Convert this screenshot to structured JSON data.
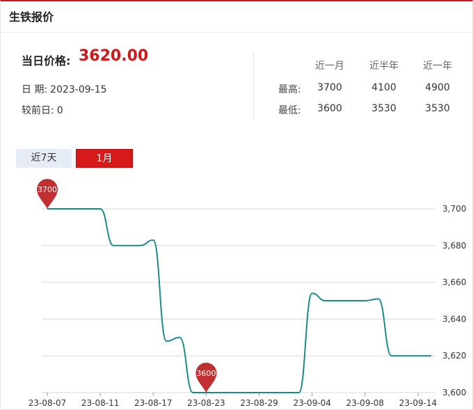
{
  "panel": {
    "title": "生铁报价"
  },
  "current": {
    "label": "当日价格:",
    "price": "3620.00"
  },
  "date": {
    "label": "日 期:",
    "value": "2023-09-15"
  },
  "change": {
    "label": "较前日:",
    "value": "0"
  },
  "stats": {
    "headers": [
      "近一月",
      "近半年",
      "近一年"
    ],
    "rows": [
      {
        "label": "最高:",
        "values": [
          "3700",
          "4100",
          "4900"
        ]
      },
      {
        "label": "最低:",
        "values": [
          "3600",
          "3530",
          "3530"
        ]
      }
    ]
  },
  "tabs": [
    {
      "label": "近7天",
      "active": false
    },
    {
      "label": "1月",
      "active": true
    }
  ],
  "colors": {
    "accent": "#d61a1a",
    "line": "#1a8a8f",
    "grid": "#d9d9d9",
    "marker": "#c03030"
  },
  "chart_data": {
    "type": "line",
    "x": [
      "23-08-07",
      "23-08-08",
      "23-08-09",
      "23-08-10",
      "23-08-11",
      "23-08-14",
      "23-08-15",
      "23-08-16",
      "23-08-17",
      "23-08-18",
      "23-08-21",
      "23-08-22",
      "23-08-23",
      "23-08-24",
      "23-08-25",
      "23-08-28",
      "23-08-29",
      "23-08-30",
      "23-08-31",
      "23-09-01",
      "23-09-04",
      "23-09-05",
      "23-09-06",
      "23-09-07",
      "23-09-08",
      "23-09-11",
      "23-09-12",
      "23-09-13",
      "23-09-14",
      "23-09-15"
    ],
    "series": [
      {
        "values": [
          3700,
          3700,
          3700,
          3700,
          3700,
          3680,
          3680,
          3680,
          3683,
          3628,
          3630,
          3600,
          3600,
          3600,
          3600,
          3600,
          3600,
          3600,
          3600,
          3600,
          3654,
          3650,
          3650,
          3650,
          3650,
          3651,
          3620,
          3620,
          3620,
          3620
        ]
      }
    ],
    "x_tick_labels": [
      "23-08-07",
      "23-08-11",
      "23-08-17",
      "23-08-23",
      "23-08-29",
      "23-09-04",
      "23-09-08",
      "23-09-14"
    ],
    "x_tick_index": [
      0,
      4,
      8,
      12,
      16,
      20,
      24,
      28
    ],
    "y_ticks": [
      "3,600",
      "3,620",
      "3,640",
      "3,660",
      "3,680",
      "3,700"
    ],
    "ylim": [
      3600,
      3700
    ],
    "y_axis_position": "right",
    "grid": true,
    "markers": [
      {
        "index": 0,
        "label": "3700"
      },
      {
        "index": 12,
        "label": "3600"
      }
    ]
  }
}
